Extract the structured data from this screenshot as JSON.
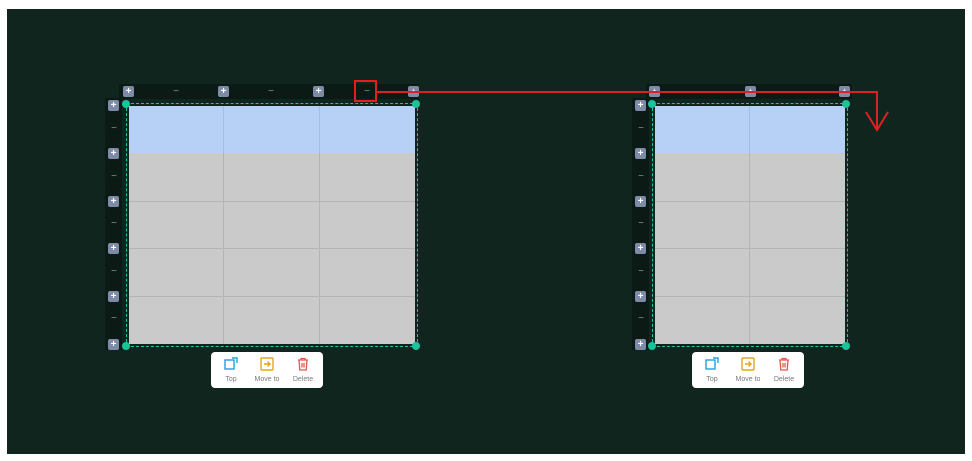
{
  "toolbar_items": {
    "top": "Top",
    "move_to": "Move to",
    "delete": "Delete"
  },
  "controls": {
    "plus": "+",
    "minus": "−"
  },
  "tables": [
    {
      "name": "left-table",
      "columns": 3,
      "rows": 5,
      "header_rows": 1
    },
    {
      "name": "right-table",
      "columns": 2,
      "rows": 5,
      "header_rows": 1
    }
  ],
  "annotation": {
    "highlight": "delete-column-button",
    "arrow": "column removed from table",
    "color": "#e02020"
  },
  "colors": {
    "canvas": "#11251f",
    "header_row": "#b7d1f6",
    "body_cells": "#cacaca",
    "selection": "#19c49b",
    "insert_button": "#7d8aa8"
  }
}
